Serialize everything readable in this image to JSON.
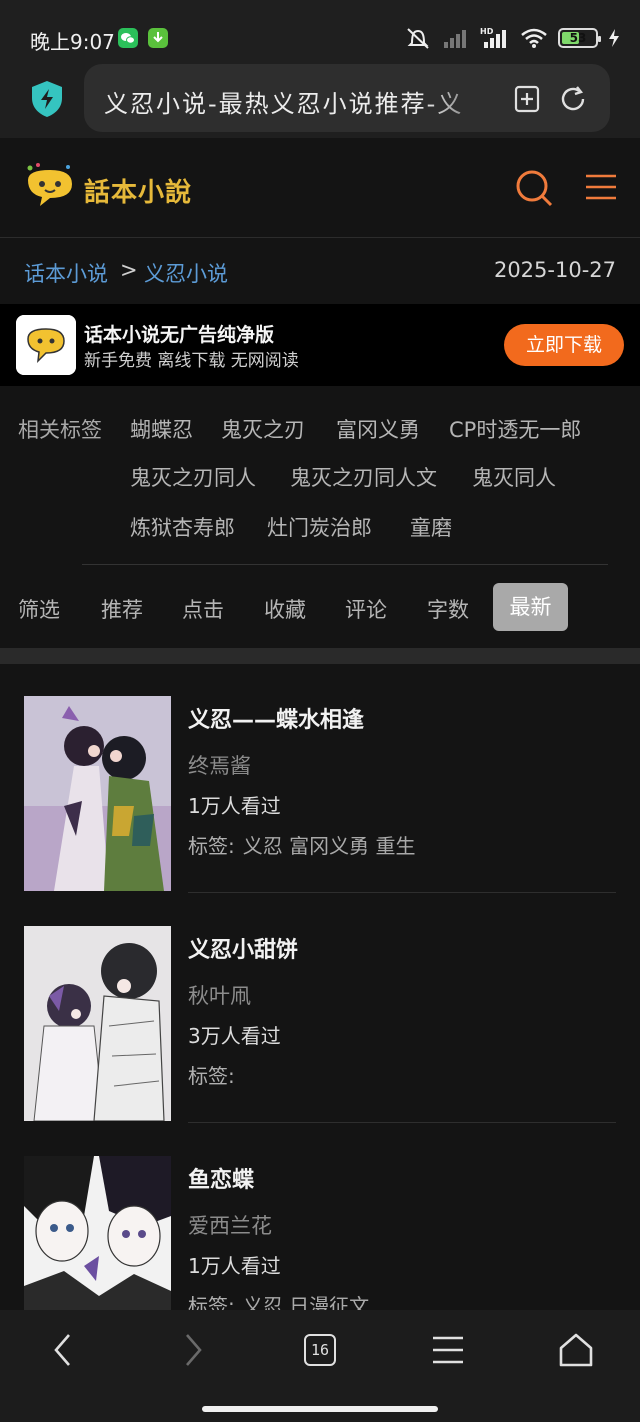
{
  "status_bar": {
    "time": "晚上9:07",
    "battery_level": "53",
    "battery_fraction": 0.53,
    "icons": [
      "wechat-icon",
      "download-icon",
      "mute-icon",
      "no-signal-icon",
      "hd-signal-icon",
      "wifi-icon",
      "battery-icon",
      "charging-icon"
    ]
  },
  "browser": {
    "url_title": "义忍小说-最热义忍小说推荐-义",
    "icons": [
      "shield-icon",
      "add-bookmark-icon",
      "refresh-icon"
    ]
  },
  "site": {
    "logo_text": "話本小說",
    "icons": [
      "search-icon",
      "menu-icon"
    ]
  },
  "breadcrumb": {
    "home": "话本小说",
    "separator": ">",
    "current": "义忍小说",
    "date": "2025-10-27"
  },
  "promo": {
    "title": "话本小说无广告纯净版",
    "subtitle": "新手免费 离线下载 无网阅读",
    "button": "立即下载"
  },
  "tags": {
    "label": "相关标签",
    "items": [
      "蝴蝶忍",
      "鬼灭之刃",
      "富冈义勇",
      "CP时透无一郎",
      "鬼灭之刃同人",
      "鬼灭之刃同人文",
      "鬼灭同人",
      "炼狱杏寿郎",
      "灶门炭治郎",
      "童磨"
    ]
  },
  "sort": {
    "items": [
      "筛选",
      "推荐",
      "点击",
      "收藏",
      "评论",
      "字数"
    ],
    "active": "最新"
  },
  "books": [
    {
      "title": "义忍——蝶水相逢",
      "author": "终焉酱",
      "views": "1万人看过",
      "tags_label": "标签:",
      "tags": "义忍 富冈义勇 重生"
    },
    {
      "title": "义忍小甜饼",
      "author": "秋叶凧",
      "views": "3万人看过",
      "tags_label": "标签:",
      "tags": ""
    },
    {
      "title": "鱼恋蝶",
      "author": "爱西兰花",
      "views": "1万人看过",
      "tags_label": "标签:",
      "tags": "义忍 日漫征文"
    }
  ],
  "bottom_nav": {
    "tab_count": "16",
    "icons": [
      "back-icon",
      "forward-icon",
      "tabs-icon",
      "menu-icon",
      "home-icon"
    ]
  },
  "colors": {
    "accent": "#f26a1d",
    "link": "#5c9bd6",
    "logo": "#e6b93a",
    "background": "#141414"
  }
}
